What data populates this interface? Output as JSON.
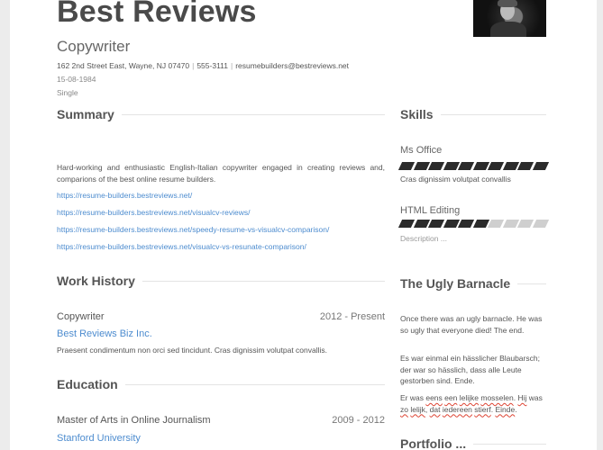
{
  "header": {
    "name": "Best Reviews",
    "title": "Copywriter",
    "address": "162 2nd Street East, Wayne, NJ 07470",
    "phone": "555-3111",
    "email": "resumebuilders@bestreviews.net",
    "separator": "|",
    "dob": "15-08-1984",
    "marital_status": "Single",
    "photo": "profile-photo"
  },
  "summary": {
    "heading": "Summary",
    "text": "Hard-working and enthusiastic English-Italian copywriter engaged in creating reviews and, comparions of the best online resume builders.",
    "links": [
      "https://resume-builders.bestreviews.net/",
      "https://resume-builders.bestreviews.net/visualcv-reviews/",
      "https://resume-builders.bestreviews.net/speedy-resume-vs-visualcv-comparison/",
      "https://resume-builders.bestreviews.net/visualcv-vs-resunate-comparison/"
    ]
  },
  "work_history": {
    "heading": "Work History",
    "items": [
      {
        "position": "Copywriter",
        "dates": "2012 - Present",
        "company": "Best Reviews Biz Inc.",
        "description": "Praesent condimentum non orci sed tincidunt. Cras dignissim volutpat convallis."
      }
    ]
  },
  "education": {
    "heading": "Education",
    "items": [
      {
        "degree": "Master of Arts in Online Journalism",
        "dates": "2009 - 2012",
        "school": "Stanford University"
      }
    ]
  },
  "skills": {
    "heading": "Skills",
    "items": [
      {
        "name": "Ms Office",
        "level": 10,
        "max": 10,
        "description": "Cras dignissim volutpat convallis"
      },
      {
        "name": "HTML Editing",
        "level": 6,
        "max": 10,
        "description": "Description ..."
      }
    ]
  },
  "barnacle": {
    "heading": "The Ugly Barnacle",
    "paragraphs": [
      "Once there was an ugly barnacle. He was so ugly that everyone died! The end.",
      "Es war einmal ein hässlicher Blaubarsch; der war so hässlich, dass alle Leute gestorben sind. Ende."
    ],
    "dutch_words": [
      "Er was ",
      "eens",
      " ",
      "een",
      " ",
      "lelijke",
      " ",
      "mosselen",
      ". ",
      "Hij",
      " was ",
      "zo",
      " ",
      "lelijk",
      ", ",
      "dat",
      " ",
      "iedereen",
      " ",
      "stierf",
      ". ",
      "Einde",
      "."
    ]
  },
  "portfolio": {
    "heading": "Portfolio ..."
  }
}
